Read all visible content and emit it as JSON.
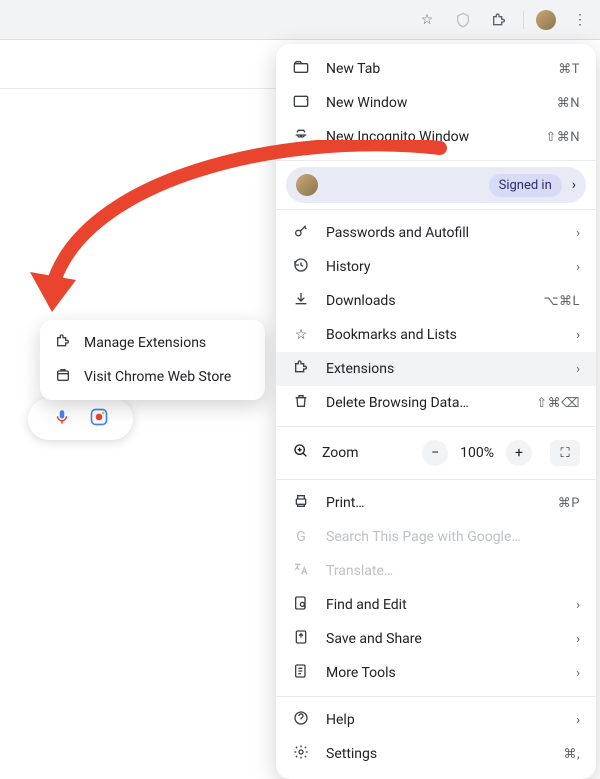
{
  "toolbar": {
    "star_icon": "star",
    "shield_icon": "shield",
    "puzzle_icon": "puzzle",
    "avatar": "avatar",
    "kebab": "more"
  },
  "signedin": {
    "label": "Signed in"
  },
  "menu": {
    "new_tab": {
      "label": "New Tab",
      "shortcut": "⌘T"
    },
    "new_window": {
      "label": "New Window",
      "shortcut": "⌘N"
    },
    "new_incognito": {
      "label": "New Incognito Window",
      "shortcut": "⇧⌘N"
    },
    "passwords": {
      "label": "Passwords and Autofill"
    },
    "history": {
      "label": "History"
    },
    "downloads": {
      "label": "Downloads",
      "shortcut": "⌥⌘L"
    },
    "bookmarks": {
      "label": "Bookmarks and Lists"
    },
    "extensions": {
      "label": "Extensions"
    },
    "delete_data": {
      "label": "Delete Browsing Data…",
      "shortcut": "⇧⌘⌫"
    },
    "zoom": {
      "label": "Zoom",
      "value": "100%"
    },
    "print": {
      "label": "Print…",
      "shortcut": "⌘P"
    },
    "search_page": {
      "label": "Search This Page with Google…"
    },
    "translate": {
      "label": "Translate…"
    },
    "find_edit": {
      "label": "Find and Edit"
    },
    "save_share": {
      "label": "Save and Share"
    },
    "more_tools": {
      "label": "More Tools"
    },
    "help": {
      "label": "Help"
    },
    "settings": {
      "label": "Settings",
      "shortcut": "⌘,"
    }
  },
  "submenu": {
    "manage": "Manage Extensions",
    "webstore": "Visit Chrome Web Store"
  }
}
